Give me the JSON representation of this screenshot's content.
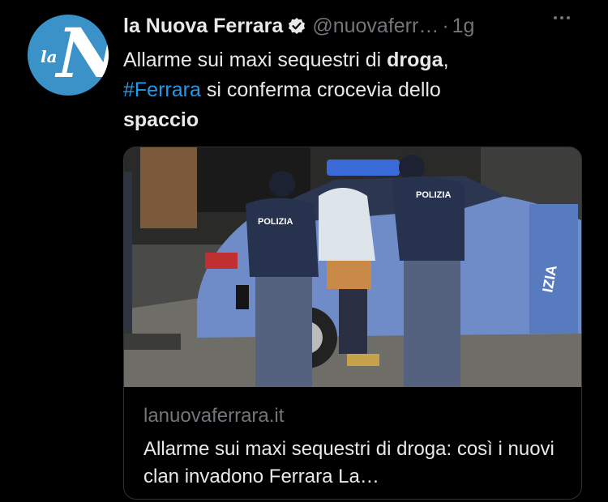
{
  "account": {
    "name": "la Nuova Ferrara",
    "handle": "@nuovaferr…",
    "separator": "·",
    "time": "1g",
    "avatar_text_small": "la",
    "avatar_text_big": "N",
    "verified_icon": "verified-badge-icon"
  },
  "tweet": {
    "line1_a": "Allarme sui maxi sequestri di ",
    "line1_b": "droga",
    "line1_c": ",",
    "hashtag": "#Ferrara",
    "line2": " si conferma crocevia dello",
    "line3": "spaccio"
  },
  "card": {
    "domain": "lanuovaferrara.it",
    "title": "Allarme sui maxi sequestri di droga: così i nuovi clan invadono Ferrara La…",
    "image_text_left": "POLIZIA",
    "image_text_right": "POLIZIA",
    "image_text_car": "IZIA"
  },
  "colors": {
    "background": "#000000",
    "text": "#e7e9ea",
    "secondary": "#71767b",
    "link": "#1d9bf0",
    "avatar": "#3a92c8"
  }
}
